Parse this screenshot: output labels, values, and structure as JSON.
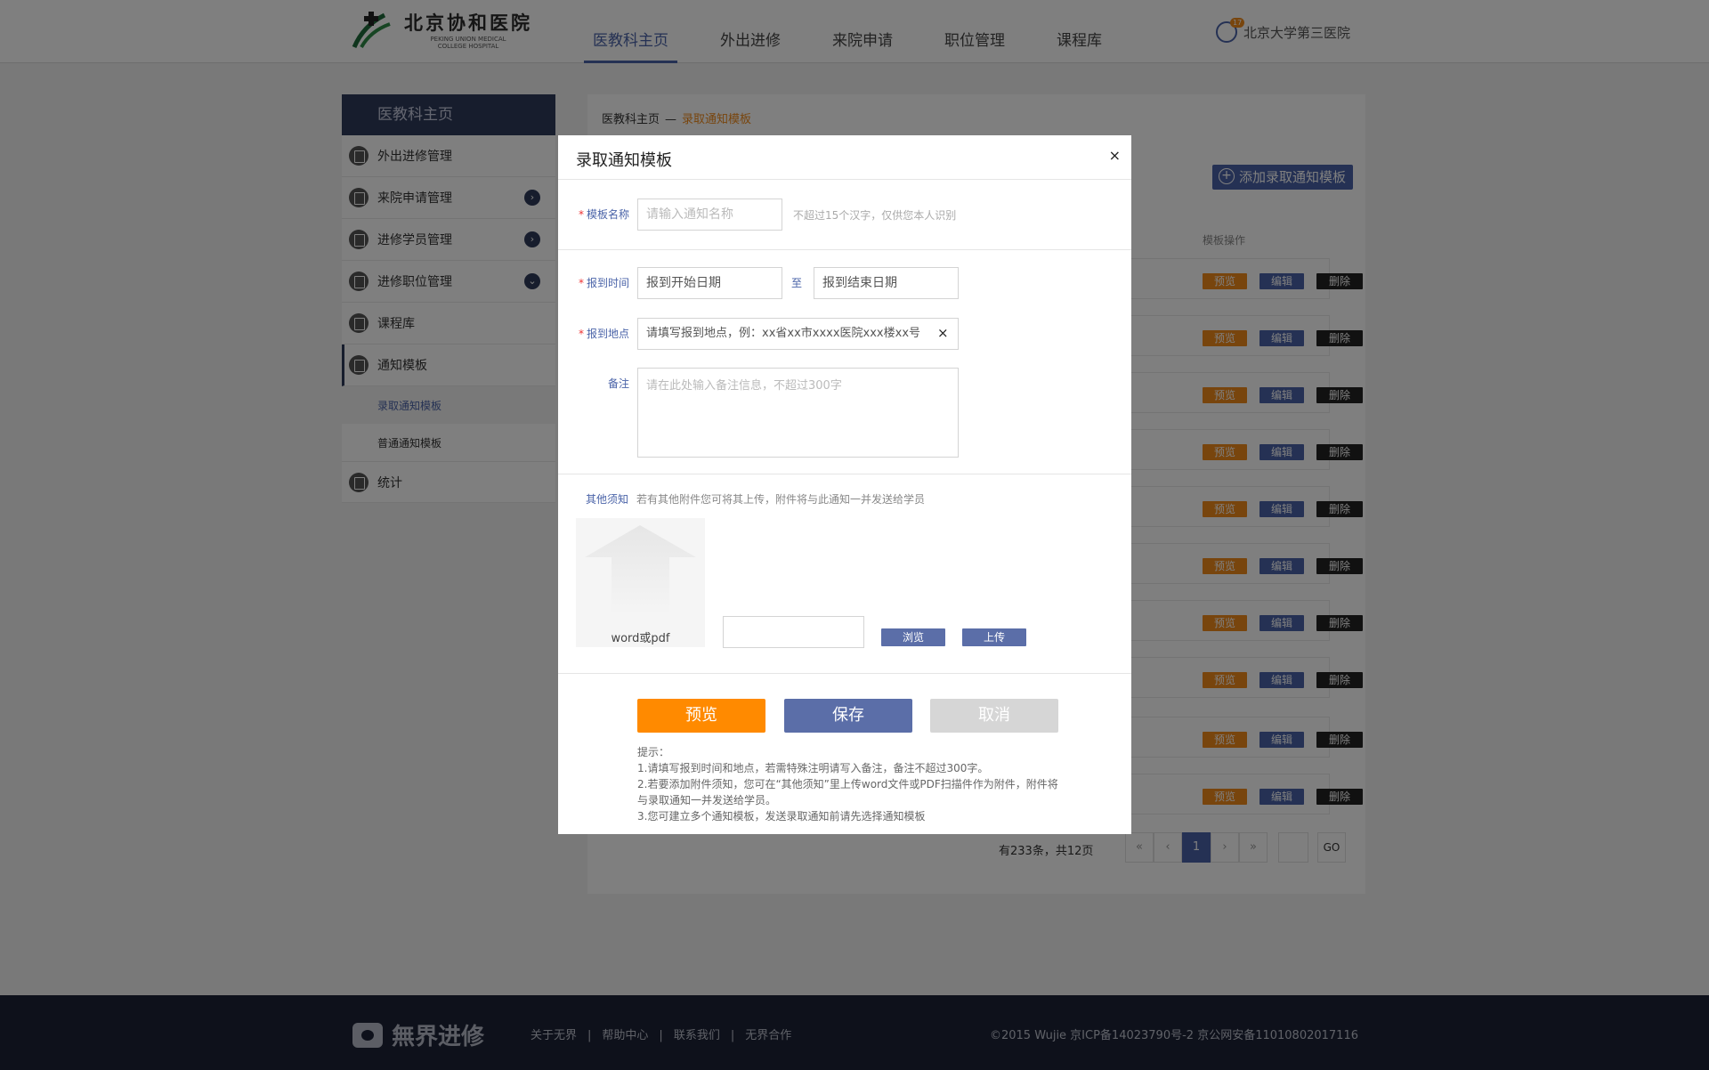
{
  "header": {
    "logo_cn": "北京协和医院",
    "logo_en_1": "PEKING UNION MEDICAL",
    "logo_en_2": "COLLEGE HOSPITAL",
    "nav": [
      "医教科主页",
      "外出进修",
      "来院申请",
      "职位管理",
      "课程库"
    ],
    "active_nav": "医教科主页",
    "user_badge": "17",
    "user_name": "北京大学第三医院"
  },
  "sidebar": {
    "title": "医教科主页",
    "items": [
      {
        "label": "外出进修管理",
        "arrow": ""
      },
      {
        "label": "来院申请管理",
        "arrow": "›"
      },
      {
        "label": "进修学员管理",
        "arrow": "›"
      },
      {
        "label": "进修职位管理",
        "arrow": "⌄"
      },
      {
        "label": "课程库",
        "arrow": ""
      },
      {
        "label": "通知模板",
        "arrow": ""
      }
    ],
    "subitems": [
      "录取通知模板",
      "普通通知模板"
    ],
    "last_item": "统计"
  },
  "main": {
    "breadcrumb_home": "医教科主页",
    "breadcrumb_sep": "—",
    "breadcrumb_current": "录取通知模板",
    "add_button": "添加录取通知模板",
    "ops_header": "模板操作",
    "row_buttons": {
      "preview": "预览",
      "edit": "编辑",
      "delete": "删除"
    },
    "row_count": 10,
    "pager_text": "有233条，共12页",
    "pager": [
      "«",
      "‹",
      "1",
      "›",
      "»"
    ],
    "pager_go": "GO"
  },
  "modal": {
    "title": "录取通知模板",
    "close": "×",
    "template_name_label": "模板名称",
    "template_name_placeholder": "请输入通知名称",
    "template_name_hint": "不超过15个汉字，仅供您本人识别",
    "report_time_label": "报到时间",
    "start_date_placeholder": "报到开始日期",
    "to_text": "至",
    "end_date_placeholder": "报到结束日期",
    "report_place_label": "报到地点",
    "report_place_placeholder": "请填写报到地点，例：xx省xx市xxxx医院xxx楼xx号",
    "clear": "×",
    "remark_label": "备注",
    "remark_placeholder": "请在此处输入备注信息，不超过300字",
    "other_label": "其他须知",
    "other_hint": "若有其他附件您可将其上传，附件将与此通知一并发送给学员",
    "upload_text": "word或pdf",
    "browse_button": "浏览",
    "upload_button": "上传",
    "preview_button": "预览",
    "save_button": "保存",
    "cancel_button": "取消",
    "tips_title": "提示：",
    "tips": [
      "1.请填写报到时间和地点，若需特殊注明请写入备注，备注不超过300字。",
      "2.若要添加附件须知，您可在“其他须知”里上传word文件或PDF扫描件作为附件，附件将与录取通知一并发送给学员。",
      "3.您可建立多个通知模板，发送录取通知前请先选择通知模板"
    ]
  },
  "footer": {
    "logo_text": "無界进修",
    "links": [
      "关于无界",
      "帮助中心",
      "联系我们",
      "无界合作"
    ],
    "copyright": "©2015 Wujie 京ICP备14023790号-2  京公网安备11010802017116"
  },
  "colors": {
    "brand_blue": "#4a63a8",
    "accent_orange": "#f08a1b",
    "dark_navy": "#2f3a5a",
    "cancel_gray": "#d6d6d6"
  }
}
